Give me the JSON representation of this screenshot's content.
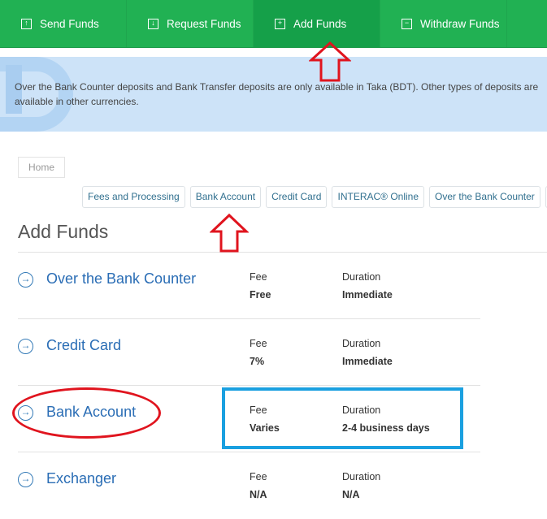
{
  "nav": [
    {
      "label": "Send Funds",
      "icon": "upload-box-icon"
    },
    {
      "label": "Request Funds",
      "icon": "download-box-icon"
    },
    {
      "label": "Add Funds",
      "icon": "plus-box-icon",
      "active": true
    },
    {
      "label": "Withdraw Funds",
      "icon": "minus-box-icon"
    }
  ],
  "banner": {
    "text": "Over the Bank Counter deposits and Bank Transfer deposits are only available in Taka (BDT). Other types of deposits are available in other currencies."
  },
  "breadcrumb": {
    "home": "Home"
  },
  "pills": [
    "Fees and Processing",
    "Bank Account",
    "Credit Card",
    "INTERAC® Online",
    "Over the Bank Counter"
  ],
  "title": "Add Funds",
  "methods": [
    {
      "name": "Over the Bank Counter",
      "fee_label": "Fee",
      "fee": "Free",
      "duration_label": "Duration",
      "duration": "Immediate"
    },
    {
      "name": "Credit Card",
      "fee_label": "Fee",
      "fee": "7%",
      "duration_label": "Duration",
      "duration": "Immediate"
    },
    {
      "name": "Bank Account",
      "fee_label": "Fee",
      "fee": "Varies",
      "duration_label": "Duration",
      "duration": "2-4 business days"
    },
    {
      "name": "Exchanger",
      "fee_label": "Fee",
      "fee": "N/A",
      "duration_label": "Duration",
      "duration": "N/A"
    }
  ],
  "colors": {
    "nav": "#21b153",
    "annotation_red": "#e0141e",
    "annotation_blue": "#1aa0e0"
  }
}
